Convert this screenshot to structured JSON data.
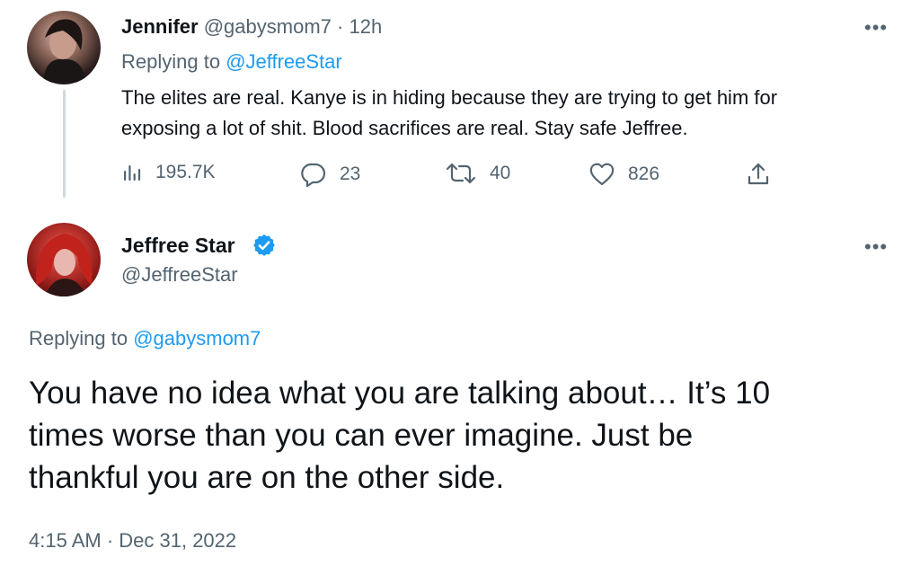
{
  "reply_tweet": {
    "display_name": "Jennifer",
    "handle": "@gabysmom7",
    "separator": "·",
    "time": "12h",
    "replying_prefix": "Replying to",
    "replying_handle": "@JeffreeStar",
    "text_line1": "The elites are real. Kanye is in hiding because they are trying to get him for",
    "text_line2": "exposing a lot of shit. Blood sacrifices are real. Stay safe Jeffree.",
    "more": "•••",
    "stats": {
      "views": "195.7K",
      "replies": "23",
      "retweets": "40",
      "likes": "826"
    }
  },
  "main_tweet": {
    "display_name": "Jeffree Star",
    "handle": "@JeffreeStar",
    "verified": true,
    "more": "•••",
    "replying_prefix": "Replying to",
    "replying_handle": "@gabysmom7",
    "text_line1": "You have no idea what you are talking about… It’s 10",
    "text_line2": "times worse than you can ever imagine. Just be",
    "text_line3": "thankful you are on the other side.",
    "timestamp": "4:15 AM · Dec 31, 2022"
  },
  "colors": {
    "link": "#1d9bf0",
    "muted": "#536471",
    "verified": "#1d9bf0"
  },
  "icons": [
    "analytics-icon",
    "reply-icon",
    "retweet-icon",
    "like-icon",
    "share-icon",
    "verified-badge-icon",
    "more-icon"
  ]
}
